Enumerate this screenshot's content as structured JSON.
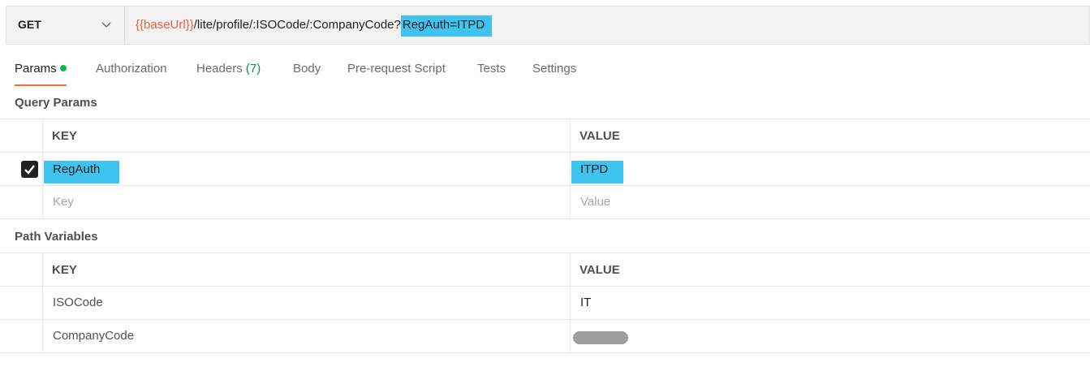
{
  "request": {
    "method": "GET",
    "url_var": "{{baseUrl}}",
    "url_path": "/lite/profile/:ISOCode/:CompanyCode?",
    "url_query": "RegAuth=ITPD"
  },
  "tabs": [
    {
      "label": "Params",
      "active": true
    },
    {
      "label": "Authorization"
    },
    {
      "label": "Headers",
      "count": "(7)"
    },
    {
      "label": "Body"
    },
    {
      "label": "Pre-request Script"
    },
    {
      "label": "Tests"
    },
    {
      "label": "Settings"
    }
  ],
  "query_params": {
    "title": "Query Params",
    "key_header": "KEY",
    "value_header": "VALUE",
    "rows": [
      {
        "key": "RegAuth",
        "value": "ITPD",
        "checked": true
      }
    ],
    "key_placeholder": "Key",
    "value_placeholder": "Value"
  },
  "path_variables": {
    "title": "Path Variables",
    "key_header": "KEY",
    "value_header": "VALUE",
    "rows": [
      {
        "key": "ISOCode",
        "value": "IT"
      },
      {
        "key": "CompanyCode",
        "value": ""
      }
    ]
  },
  "colors": {
    "accent": "#f26b3a",
    "variable": "#e8613e",
    "highlight": "#3fc4f0",
    "status_dot": "#0cbb52",
    "count": "#0f8a5f"
  },
  "icons": {
    "method_dropdown": "chevron-down-icon",
    "checkbox": "checkmark-icon",
    "redaction": "redacted-value"
  }
}
